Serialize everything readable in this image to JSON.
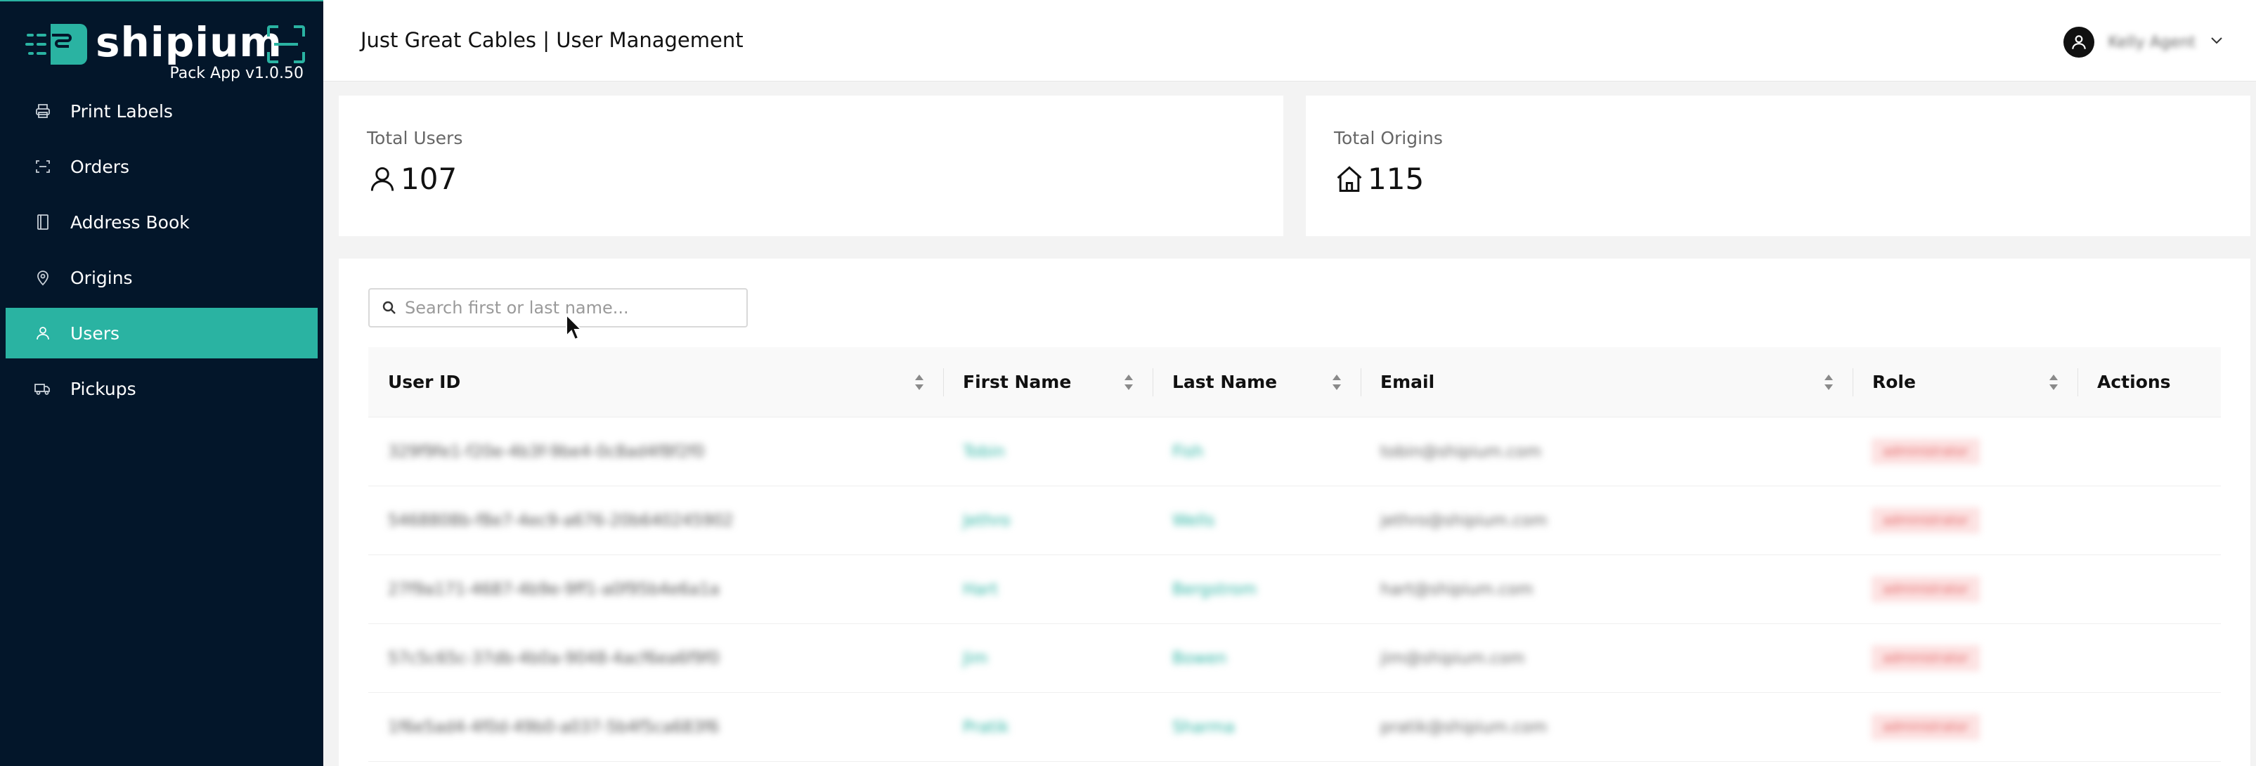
{
  "brand": {
    "name": "shipium",
    "version": "Pack App v1.0.50",
    "color": "#2ab3a2"
  },
  "sidebar": {
    "items": [
      {
        "label": "Print Labels",
        "icon": "printer-icon",
        "active": false
      },
      {
        "label": "Orders",
        "icon": "orders-icon",
        "active": false
      },
      {
        "label": "Address Book",
        "icon": "book-icon",
        "active": false
      },
      {
        "label": "Origins",
        "icon": "location-pin-icon",
        "active": false
      },
      {
        "label": "Users",
        "icon": "user-icon",
        "active": true
      },
      {
        "label": "Pickups",
        "icon": "truck-icon",
        "active": false
      }
    ]
  },
  "header": {
    "title": "Just Great Cables | User Management",
    "user_name": "Kelly Agent"
  },
  "stats": {
    "users": {
      "label": "Total Users",
      "value": "107",
      "icon": "user-icon"
    },
    "origins": {
      "label": "Total Origins",
      "value": "115",
      "icon": "home-icon"
    }
  },
  "search": {
    "placeholder": "Search first or last name..."
  },
  "table": {
    "columns": [
      "User ID",
      "First Name",
      "Last Name",
      "Email",
      "Role",
      "Actions"
    ],
    "rows": [
      {
        "id": "329f9fe1-f20e-4b3f-9be4-0c8ad4f8f2f0",
        "first": "Tobin",
        "last": "Fish",
        "email": "tobin@shipium.com",
        "role": "administrator"
      },
      {
        "id": "5468808b-f8e7-4ec9-a676-20b640245902",
        "first": "Jethro",
        "last": "Wells",
        "email": "jethro@shipium.com",
        "role": "administrator"
      },
      {
        "id": "27f9a171-4687-4b9e-9ff1-a0f95b4e6a1a",
        "first": "Hart",
        "last": "Bergstrom",
        "email": "hart@shipium.com",
        "role": "administrator"
      },
      {
        "id": "57c5c65c-37db-4b0a-9048-4acf6ea6f9f0",
        "first": "Jim",
        "last": "Bowen",
        "email": "jim@shipium.com",
        "role": "administrator"
      },
      {
        "id": "1f6e5ad4-4f0d-49b0-a037-5b4f5ca683f6",
        "first": "Pratik",
        "last": "Sharma",
        "email": "pratik@shipium.com",
        "role": "administrator"
      }
    ]
  }
}
